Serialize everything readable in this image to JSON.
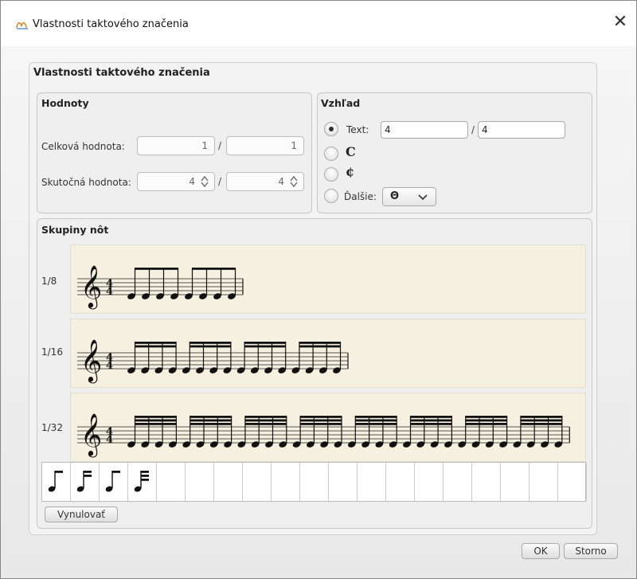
{
  "window": {
    "title": "Vlastnosti taktového značenia",
    "close_glyph": "✕"
  },
  "dialog": {
    "heading": "Vlastnosti taktového značenia"
  },
  "values_group": {
    "title": "Hodnoty",
    "total_label": "Celková hodnota:",
    "total_numerator": "1",
    "total_denominator": "1",
    "actual_label": "Skutočná hodnota:",
    "actual_numerator": "4",
    "actual_denominator": "4",
    "separator": "/"
  },
  "appearance_group": {
    "title": "Vzhľad",
    "text_option_label": "Text:",
    "text_numerator": "4",
    "text_denominator": "4",
    "separator": "/",
    "common_time_symbol": "C",
    "cut_time_symbol": "¢",
    "other_label": "Ďalšie:",
    "other_selected": "Θ",
    "selected_option": "text"
  },
  "groups": {
    "title": "Skupiny nôt",
    "rows": [
      {
        "label": "1/8",
        "beam_levels": 1,
        "notes": 8,
        "group_size": 4
      },
      {
        "label": "1/16",
        "beam_levels": 2,
        "notes": 16,
        "group_size": 4
      },
      {
        "label": "1/32",
        "beam_levels": 3,
        "notes": 32,
        "group_size": 4
      }
    ],
    "palette": [
      "eighth-note",
      "sixteenth-note",
      "eighth-rest-like",
      "thirty-second-note"
    ],
    "reset_label": "Vynulovať"
  },
  "footer": {
    "ok_label": "OK",
    "cancel_label": "Storno"
  },
  "colors": {
    "staff_background": "#f5f0df",
    "panel": "#efefef"
  }
}
